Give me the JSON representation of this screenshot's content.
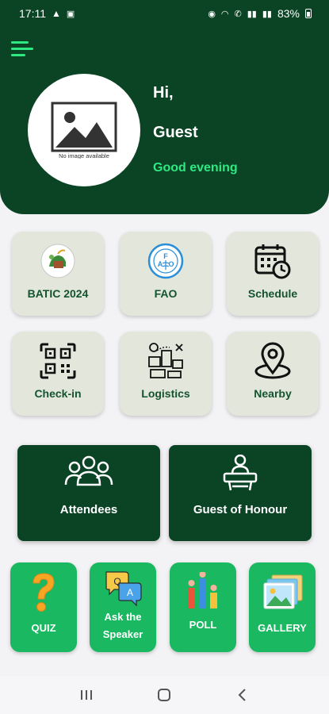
{
  "status_bar": {
    "time": "17:11",
    "battery": "83%"
  },
  "header": {
    "greeting": "Hi,",
    "user_name": "Guest",
    "time_greeting": "Good evening",
    "avatar_placeholder": "No image available"
  },
  "menu": {
    "tiles": [
      {
        "label": "BATIC 2024",
        "icon": "batic-logo-icon"
      },
      {
        "label": "FAO",
        "icon": "fao-logo-icon"
      },
      {
        "label": "Schedule",
        "icon": "calendar-clock-icon"
      },
      {
        "label": "Check-in",
        "icon": "qr-code-icon"
      },
      {
        "label": "Logistics",
        "icon": "logistics-icon"
      },
      {
        "label": "Nearby",
        "icon": "location-pin-icon"
      }
    ],
    "cards": [
      {
        "label": "Attendees",
        "icon": "group-icon"
      },
      {
        "label": "Guest of Honour",
        "icon": "speaker-podium-icon"
      }
    ],
    "actions": [
      {
        "label": "QUIZ",
        "icon": "question-mark-icon"
      },
      {
        "label_line1": "Ask the",
        "label_line2": "Speaker",
        "icon": "chat-bubbles-icon"
      },
      {
        "label": "POLL",
        "icon": "poll-bars-icon"
      },
      {
        "label": "GALLERY",
        "icon": "gallery-icon"
      }
    ]
  },
  "colors": {
    "primary_dark": "#0b4425",
    "accent_green": "#2ee882",
    "action_green": "#1bb862",
    "tile_bg": "#e2e6db"
  }
}
